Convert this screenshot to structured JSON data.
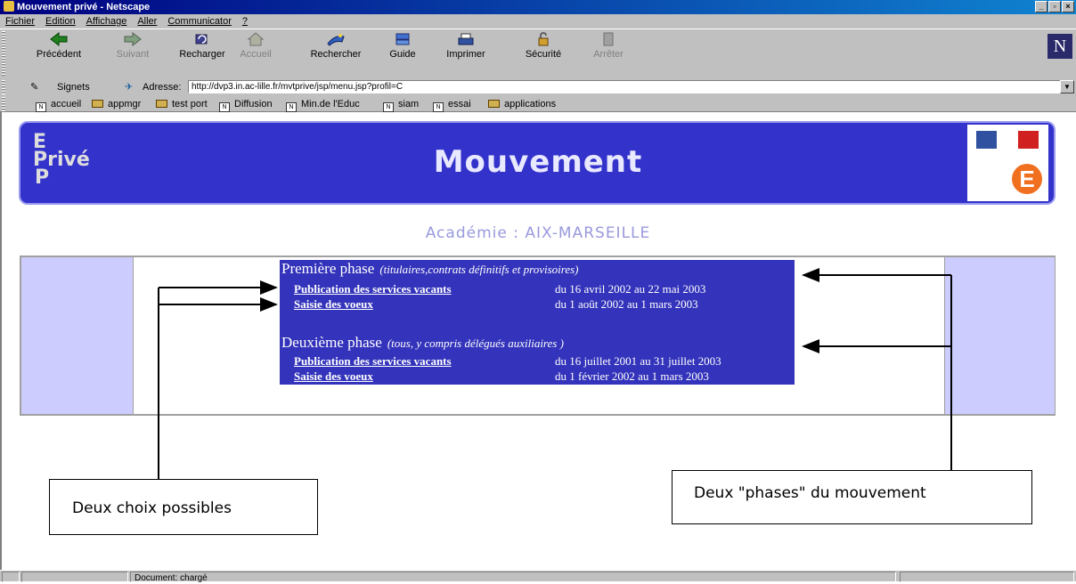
{
  "window": {
    "title": "Mouvement privé - Netscape",
    "controls": [
      "_",
      "▫",
      "×"
    ]
  },
  "menu": [
    "Fichier",
    "Edition",
    "Affichage",
    "Aller",
    "Communicator",
    "?"
  ],
  "toolbar": {
    "items": [
      {
        "label": "Précédent",
        "enabled": true
      },
      {
        "label": "Suivant",
        "enabled": false
      },
      {
        "label": "Recharger",
        "enabled": true
      },
      {
        "label": "Accueil",
        "enabled": false
      },
      {
        "label": "Rechercher",
        "enabled": true
      },
      {
        "label": "Guide",
        "enabled": true
      },
      {
        "label": "Imprimer",
        "enabled": true
      },
      {
        "label": "Sécurité",
        "enabled": true
      },
      {
        "label": "Arrêter",
        "enabled": false
      }
    ],
    "brand": "N"
  },
  "location": {
    "signets": "Signets",
    "adresse_label": "Adresse:",
    "url": "http://dvp3.in.ac-lille.fr/mvtprive/jsp/menu.jsp?profil=C"
  },
  "bookmarks": [
    {
      "label": "accueil",
      "type": "page"
    },
    {
      "label": "appmgr",
      "type": "folder"
    },
    {
      "label": "test port",
      "type": "folder"
    },
    {
      "label": "Diffusion",
      "type": "page"
    },
    {
      "label": "Min.de l'Educ",
      "type": "page"
    },
    {
      "label": "siam",
      "type": "page"
    },
    {
      "label": "essai",
      "type": "page"
    },
    {
      "label": "applications",
      "type": "folder"
    }
  ],
  "banner": {
    "logo_lines": [
      "E",
      "Privé",
      "P"
    ],
    "title": "Mouvement",
    "emblem_letter": "E"
  },
  "academie": "Académie : AIX-MARSEILLE",
  "phases": [
    {
      "title": "Première phase",
      "subtitle": "(titulaires,contrats définitifs et provisoires)",
      "rows": [
        {
          "link": "Publication des services vacants",
          "dates": "du 16 avril 2002 au 22 mai 2003"
        },
        {
          "link": "Saisie des voeux",
          "dates": "du 1 août 2002 au 1 mars 2003"
        }
      ]
    },
    {
      "title": "Deuxième phase",
      "subtitle": "(tous, y compris délégués auxiliaires )",
      "rows": [
        {
          "link": "Publication des services vacants",
          "dates": "du 16 juillet 2001 au 31 juillet 2003"
        },
        {
          "link": "Saisie des voeux",
          "dates": "du 1 février 2002 au 1 mars 2003"
        }
      ]
    }
  ],
  "callouts": {
    "left": "Deux choix possibles",
    "right": "Deux \"phases\" du mouvement"
  },
  "status": {
    "text": "Document: chargé"
  }
}
